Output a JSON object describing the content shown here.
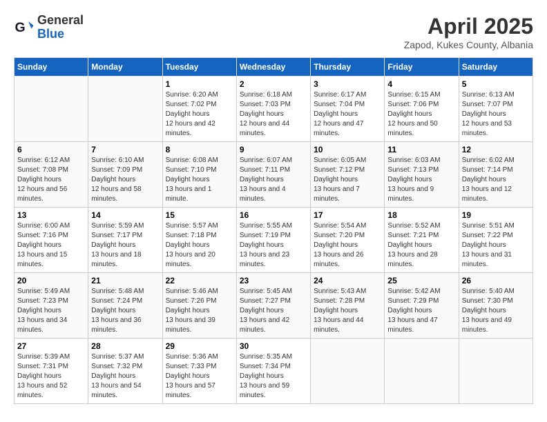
{
  "header": {
    "logo_general": "General",
    "logo_blue": "Blue",
    "month_year": "April 2025",
    "location": "Zapod, Kukes County, Albania"
  },
  "calendar": {
    "days_of_week": [
      "Sunday",
      "Monday",
      "Tuesday",
      "Wednesday",
      "Thursday",
      "Friday",
      "Saturday"
    ],
    "weeks": [
      [
        {
          "day": "",
          "info": ""
        },
        {
          "day": "",
          "info": ""
        },
        {
          "day": "1",
          "sunrise": "6:20 AM",
          "sunset": "7:02 PM",
          "daylight": "12 hours and 42 minutes."
        },
        {
          "day": "2",
          "sunrise": "6:18 AM",
          "sunset": "7:03 PM",
          "daylight": "12 hours and 44 minutes."
        },
        {
          "day": "3",
          "sunrise": "6:17 AM",
          "sunset": "7:04 PM",
          "daylight": "12 hours and 47 minutes."
        },
        {
          "day": "4",
          "sunrise": "6:15 AM",
          "sunset": "7:06 PM",
          "daylight": "12 hours and 50 minutes."
        },
        {
          "day": "5",
          "sunrise": "6:13 AM",
          "sunset": "7:07 PM",
          "daylight": "12 hours and 53 minutes."
        }
      ],
      [
        {
          "day": "6",
          "sunrise": "6:12 AM",
          "sunset": "7:08 PM",
          "daylight": "12 hours and 56 minutes."
        },
        {
          "day": "7",
          "sunrise": "6:10 AM",
          "sunset": "7:09 PM",
          "daylight": "12 hours and 58 minutes."
        },
        {
          "day": "8",
          "sunrise": "6:08 AM",
          "sunset": "7:10 PM",
          "daylight": "13 hours and 1 minute."
        },
        {
          "day": "9",
          "sunrise": "6:07 AM",
          "sunset": "7:11 PM",
          "daylight": "13 hours and 4 minutes."
        },
        {
          "day": "10",
          "sunrise": "6:05 AM",
          "sunset": "7:12 PM",
          "daylight": "13 hours and 7 minutes."
        },
        {
          "day": "11",
          "sunrise": "6:03 AM",
          "sunset": "7:13 PM",
          "daylight": "13 hours and 9 minutes."
        },
        {
          "day": "12",
          "sunrise": "6:02 AM",
          "sunset": "7:14 PM",
          "daylight": "13 hours and 12 minutes."
        }
      ],
      [
        {
          "day": "13",
          "sunrise": "6:00 AM",
          "sunset": "7:16 PM",
          "daylight": "13 hours and 15 minutes."
        },
        {
          "day": "14",
          "sunrise": "5:59 AM",
          "sunset": "7:17 PM",
          "daylight": "13 hours and 18 minutes."
        },
        {
          "day": "15",
          "sunrise": "5:57 AM",
          "sunset": "7:18 PM",
          "daylight": "13 hours and 20 minutes."
        },
        {
          "day": "16",
          "sunrise": "5:55 AM",
          "sunset": "7:19 PM",
          "daylight": "13 hours and 23 minutes."
        },
        {
          "day": "17",
          "sunrise": "5:54 AM",
          "sunset": "7:20 PM",
          "daylight": "13 hours and 26 minutes."
        },
        {
          "day": "18",
          "sunrise": "5:52 AM",
          "sunset": "7:21 PM",
          "daylight": "13 hours and 28 minutes."
        },
        {
          "day": "19",
          "sunrise": "5:51 AM",
          "sunset": "7:22 PM",
          "daylight": "13 hours and 31 minutes."
        }
      ],
      [
        {
          "day": "20",
          "sunrise": "5:49 AM",
          "sunset": "7:23 PM",
          "daylight": "13 hours and 34 minutes."
        },
        {
          "day": "21",
          "sunrise": "5:48 AM",
          "sunset": "7:24 PM",
          "daylight": "13 hours and 36 minutes."
        },
        {
          "day": "22",
          "sunrise": "5:46 AM",
          "sunset": "7:26 PM",
          "daylight": "13 hours and 39 minutes."
        },
        {
          "day": "23",
          "sunrise": "5:45 AM",
          "sunset": "7:27 PM",
          "daylight": "13 hours and 42 minutes."
        },
        {
          "day": "24",
          "sunrise": "5:43 AM",
          "sunset": "7:28 PM",
          "daylight": "13 hours and 44 minutes."
        },
        {
          "day": "25",
          "sunrise": "5:42 AM",
          "sunset": "7:29 PM",
          "daylight": "13 hours and 47 minutes."
        },
        {
          "day": "26",
          "sunrise": "5:40 AM",
          "sunset": "7:30 PM",
          "daylight": "13 hours and 49 minutes."
        }
      ],
      [
        {
          "day": "27",
          "sunrise": "5:39 AM",
          "sunset": "7:31 PM",
          "daylight": "13 hours and 52 minutes."
        },
        {
          "day": "28",
          "sunrise": "5:37 AM",
          "sunset": "7:32 PM",
          "daylight": "13 hours and 54 minutes."
        },
        {
          "day": "29",
          "sunrise": "5:36 AM",
          "sunset": "7:33 PM",
          "daylight": "13 hours and 57 minutes."
        },
        {
          "day": "30",
          "sunrise": "5:35 AM",
          "sunset": "7:34 PM",
          "daylight": "13 hours and 59 minutes."
        },
        {
          "day": "",
          "info": ""
        },
        {
          "day": "",
          "info": ""
        },
        {
          "day": "",
          "info": ""
        }
      ]
    ]
  },
  "labels": {
    "sunrise_label": "Sunrise:",
    "sunset_label": "Sunset:",
    "daylight_label": "Daylight hours"
  }
}
